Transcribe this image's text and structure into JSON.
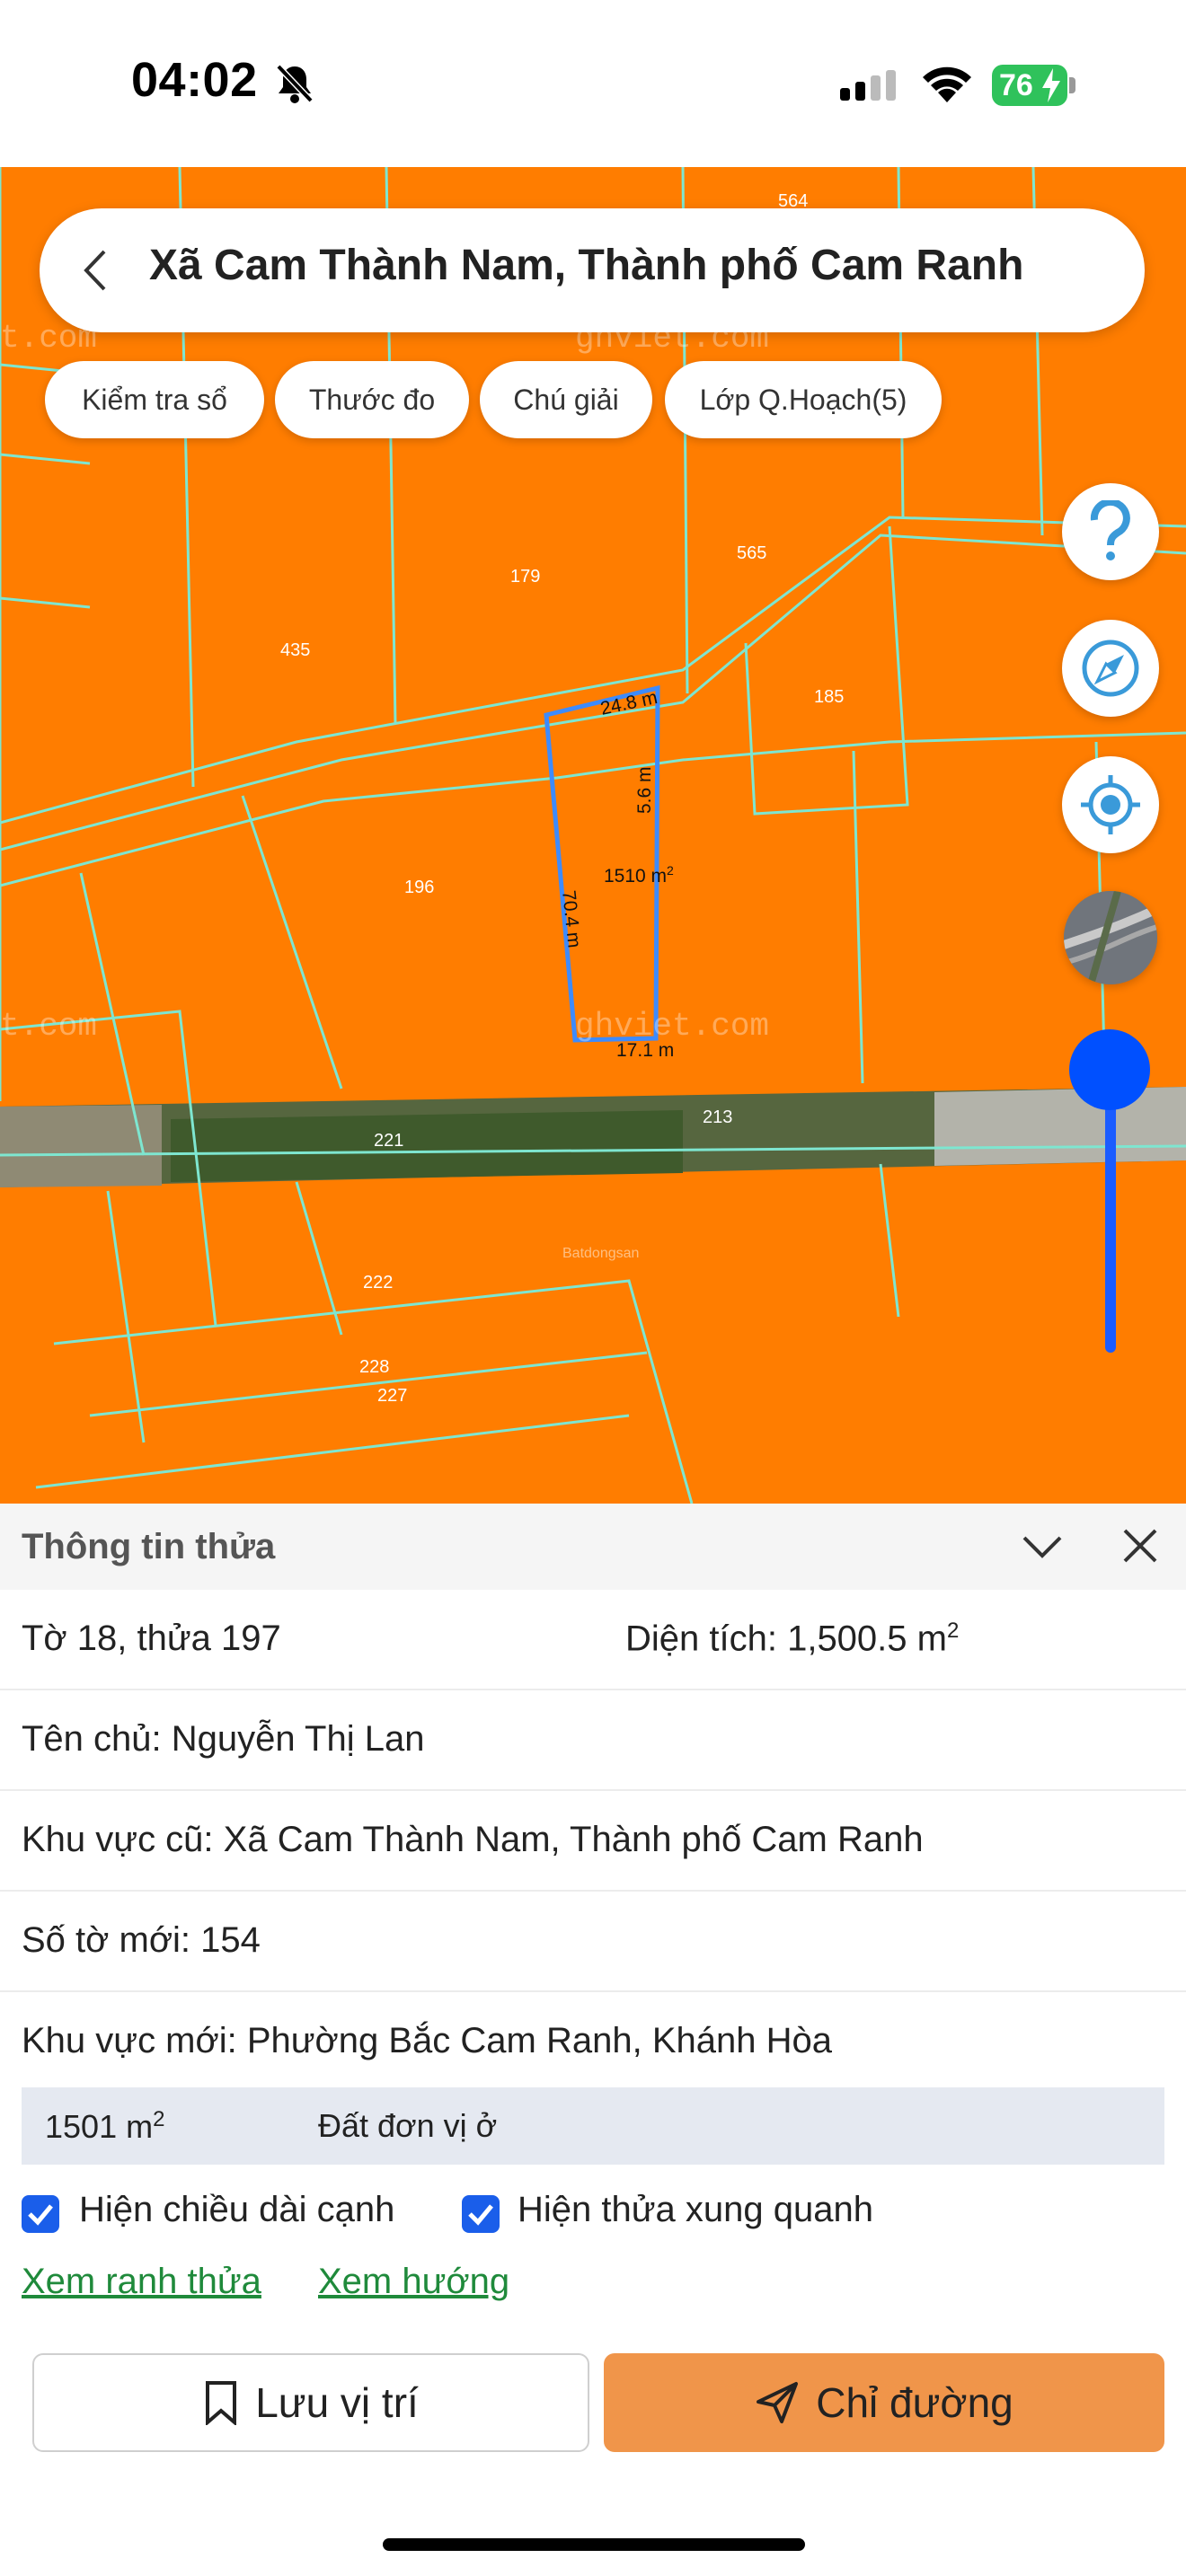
{
  "status_bar": {
    "time": "04:02",
    "battery": "76"
  },
  "search": {
    "title": "Xã Cam Thành Nam, Thành phố Cam Ranh"
  },
  "chips": [
    "Kiểm tra sổ",
    "Thước đo",
    "Chú giải",
    "Lớp Q.Hoạch(5)"
  ],
  "map": {
    "parcel_numbers": [
      "564",
      "179",
      "565",
      "435",
      "185",
      "196",
      "221",
      "213",
      "222",
      "228",
      "227"
    ],
    "selected_parcel": {
      "top_edge": "24.8 m",
      "right_edge": "5.6 m",
      "left_edge": "70.4 m",
      "bottom_edge": "17.1 m",
      "area": "1510 m",
      "area_sup": "2"
    },
    "watermarks": [
      "ghviet.com",
      "t.com",
      "ghviet.com",
      "t.com"
    ],
    "attribution": "Batdongsan",
    "fab_icons": [
      "help-icon",
      "compass-icon",
      "my-location-icon",
      "map-layer-icon"
    ]
  },
  "sheet": {
    "title": "Thông tin thửa",
    "row1_left": "Tờ 18, thửa 197",
    "row1_right": "Diện tích: 1,500.5 m",
    "row1_right_sup": "2",
    "owner": "Tên chủ: Nguyễn Thị Lan",
    "old_area": "Khu vực cũ: Xã Cam Thành Nam, Thành phố Cam Ranh",
    "new_sheet": "Số tờ mới: 154",
    "new_area": "Khu vực mới: Phường Bắc Cam Ranh, Khánh Hòa",
    "zone_area": "1501 m",
    "zone_area_sup": "2",
    "zone_type": "Đất đơn vị ở",
    "checkbox1": "Hiện chiều dài cạnh",
    "checkbox2": "Hiện thửa xung quanh",
    "link1": "Xem ranh thửa",
    "link2": "Xem hướng",
    "save_label": "Lưu vị trí",
    "route_label": "Chỉ đường"
  },
  "colors": {
    "map_fill": "#ff7d00",
    "parcel_line": "#7ee6d0",
    "selected_line": "#3d8bfd",
    "accent_button": "#f0954a",
    "link": "#1f8a3b",
    "checkbox": "#1a5eea"
  }
}
